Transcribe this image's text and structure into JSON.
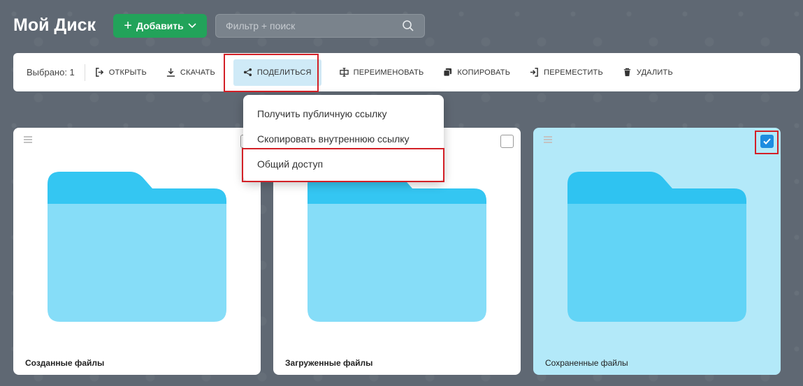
{
  "header": {
    "title": "Мой Диск",
    "add_label": "Добавить",
    "search_placeholder": "Фильтр + поиск",
    "icons": {
      "add": "plus-icon",
      "add_dropdown": "chevron-down-icon",
      "search": "search-icon"
    }
  },
  "toolbar": {
    "selected_label": "Выбрано: 1",
    "buttons": [
      {
        "label": "ОТКРЫТЬ",
        "icon": "open-icon"
      },
      {
        "label": "СКАЧАТЬ",
        "icon": "download-icon"
      },
      {
        "label": "ПОДЕЛИТЬСЯ",
        "icon": "share-icon",
        "active": true
      },
      {
        "label": "ПЕРЕИМЕНОВАТЬ",
        "icon": "rename-icon"
      },
      {
        "label": "КОПИРОВАТЬ",
        "icon": "copy-icon"
      },
      {
        "label": "ПЕРЕМЕСТИТЬ",
        "icon": "move-icon"
      },
      {
        "label": "УДАЛИТЬ",
        "icon": "trash-icon"
      }
    ]
  },
  "share_menu": {
    "items": [
      "Получить публичную ссылку",
      "Скопировать внутреннюю ссылку",
      "Общий доступ"
    ]
  },
  "folders": [
    {
      "name": "Созданные файлы",
      "checked": false
    },
    {
      "name": "Загруженные файлы",
      "checked": false
    },
    {
      "name": "Сохраненные файлы",
      "checked": true
    }
  ],
  "colors": {
    "background": "#5f6873",
    "add_button": "#22a35a",
    "share_active": "#cfeaf7",
    "selected_card": "#b3e9f9",
    "folder_tab": "#34c6f2",
    "folder_body": "#86ddf8",
    "checkbox_checked": "#1d8ce0",
    "highlight_frame": "#d32027"
  }
}
